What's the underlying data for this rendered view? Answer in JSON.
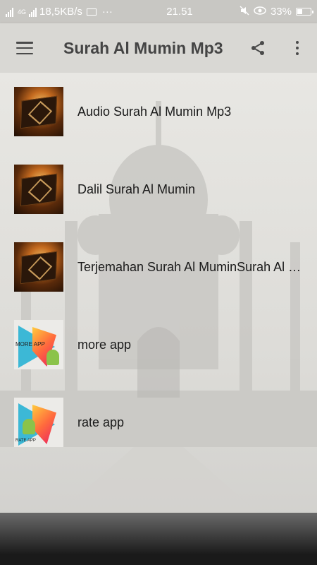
{
  "status_bar": {
    "network_speed": "18,5KB/s",
    "network_type": "4G",
    "time": "21.51",
    "battery": "33%",
    "battery_level": 0.33,
    "dots": "···"
  },
  "app_bar": {
    "title": "Surah Al Mumin Mp3",
    "menu_icon": "hamburger-menu-icon",
    "share_icon": "share-icon",
    "overflow_icon": "more-vert-icon"
  },
  "menu_items": [
    {
      "label": "Audio Surah Al Mumin Mp3",
      "icon": "quran-image"
    },
    {
      "label": "Dalil Surah Al Mumin",
      "icon": "quran-image"
    },
    {
      "label": "Terjemahan Surah Al MuminSurah Al Mumin",
      "icon": "quran-image"
    },
    {
      "label": "more app",
      "icon": "play-store-more-app-image",
      "thumb_text": "MORE APP"
    },
    {
      "label": "rate app",
      "icon": "play-store-rate-app-image",
      "thumb_text": "RATE APP"
    }
  ],
  "colors": {
    "app_bar": "#d9d8d4",
    "status_bar": "#c8c7c3",
    "background": "#e8e7e3",
    "title_text": "#444444",
    "item_text": "#1a1a1a"
  }
}
